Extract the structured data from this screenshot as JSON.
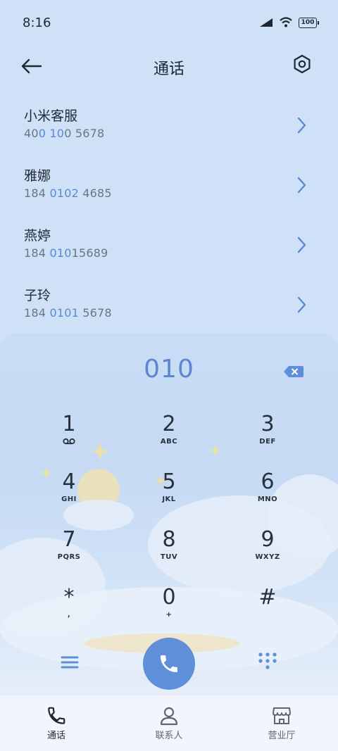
{
  "status_bar": {
    "time": "8:16",
    "battery": "100"
  },
  "header": {
    "title": "通话"
  },
  "contacts": [
    {
      "name": "小米客服",
      "number_parts": [
        "40",
        "0 10",
        "0 5678"
      ]
    },
    {
      "name": "雅娜",
      "number_parts": [
        "184 ",
        "0102",
        " 4685"
      ]
    },
    {
      "name": "燕婷",
      "number_parts": [
        "184 ",
        "010",
        "15689"
      ]
    },
    {
      "name": "子玲",
      "number_parts": [
        "184 ",
        "0101",
        " 5678"
      ]
    }
  ],
  "dialpad": {
    "display": "010",
    "keys": [
      {
        "digit": "1",
        "letters": ""
      },
      {
        "digit": "2",
        "letters": "ABC"
      },
      {
        "digit": "3",
        "letters": "DEF"
      },
      {
        "digit": "4",
        "letters": "GHI"
      },
      {
        "digit": "5",
        "letters": "JKL"
      },
      {
        "digit": "6",
        "letters": "MNO"
      },
      {
        "digit": "7",
        "letters": "PQRS"
      },
      {
        "digit": "8",
        "letters": "TUV"
      },
      {
        "digit": "9",
        "letters": "WXYZ"
      },
      {
        "digit": "*",
        "letters": ","
      },
      {
        "digit": "0",
        "letters": "+"
      },
      {
        "digit": "#",
        "letters": ""
      }
    ]
  },
  "bottom_nav": [
    {
      "label": "通话",
      "icon": "phone-icon",
      "active": true
    },
    {
      "label": "联系人",
      "icon": "person-icon",
      "active": false
    },
    {
      "label": "营业厅",
      "icon": "store-icon",
      "active": false
    }
  ],
  "colors": {
    "accent": "#5f8fd8",
    "highlight": "#5a87d6",
    "background": "#cfe1f7"
  }
}
